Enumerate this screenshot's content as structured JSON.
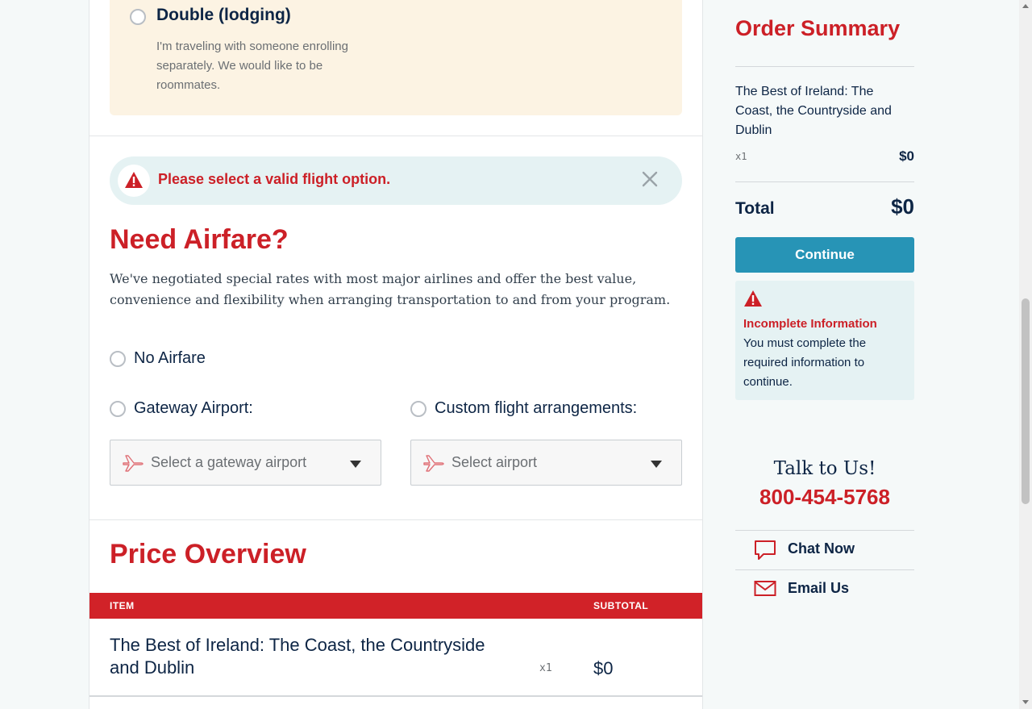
{
  "lodging": {
    "option_label": "Double (lodging)",
    "option_desc": "I'm traveling with someone enrolling separately. We would like to be roommates."
  },
  "alert": {
    "message": "Please select a valid flight option.",
    "icon": "warning-triangle-icon",
    "close_icon": "close-icon"
  },
  "airfare": {
    "heading": "Need Airfare?",
    "description": "We've negotiated special rates with most major airlines and offer the best value, convenience and flexibility when arranging transportation to and from your program.",
    "options": {
      "no_airfare": "No Airfare",
      "gateway": "Gateway Airport:",
      "custom": "Custom flight arrangements:"
    },
    "gateway_select_placeholder": "Select a gateway airport",
    "custom_select_placeholder": "Select airport"
  },
  "price_overview": {
    "heading": "Price Overview",
    "columns": {
      "item": "ITEM",
      "subtotal": "SUBTOTAL"
    },
    "rows": [
      {
        "name": "The Best of Ireland: The Coast, the Countryside and Dublin",
        "qty": "x1",
        "subtotal": "$0"
      }
    ]
  },
  "order_summary": {
    "title": "Order Summary",
    "trip_name": "The Best of Ireland: The Coast, the Countryside and Dublin",
    "qty": "x1",
    "price": "$0",
    "total_label": "Total",
    "total_value": "$0",
    "continue_label": "Continue",
    "incomplete_title": "Incomplete Information",
    "incomplete_body": "You must complete the required information to continue."
  },
  "contact": {
    "talk_label": "Talk to Us!",
    "phone": "800-454-5768",
    "chat_label": "Chat Now",
    "email_label": "Email Us"
  },
  "colors": {
    "brand_red": "#cc2027",
    "header_red": "#d12228",
    "navy": "#0d2545",
    "button_blue": "#2794b6",
    "alert_bg": "#e5f2f3",
    "lodging_bg": "#fcf3e3"
  }
}
